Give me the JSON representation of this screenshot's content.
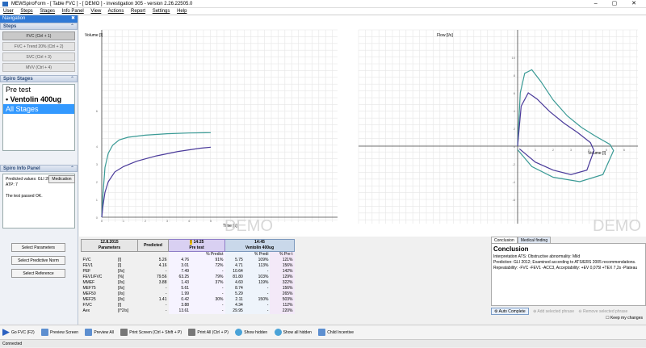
{
  "window": {
    "title": "MEWSpiroForm - [ Table FVC ] - [ DEMO ] - investigation 305 - version 2.26.22505.0",
    "controls": "– ▢ ✕"
  },
  "menu": [
    "User",
    "Steps",
    "Stages",
    "Info Panel",
    "View",
    "Actions",
    "Report",
    "Settings",
    "Help"
  ],
  "navigation": {
    "title": "Navigation",
    "pin": "✖",
    "steps_title": "Steps",
    "steps": [
      "FVC (Ctrl + 1)",
      "FVC + Trend 20% (Ctrl + 2)",
      "SVC (Ctrl + 3)",
      "MVV (Ctrl + 4)"
    ],
    "stages_title": "Spiro Stages",
    "stages": [
      "Pre test",
      "Ventolin 400ug",
      "All Stages"
    ],
    "medication_button": "Medication",
    "info_title": "Spiro Info Panel",
    "info_lines": [
      "Predicted values: GLI 2012",
      "ATP: 7",
      "",
      "The test passed OK."
    ],
    "buttons": [
      "Select Parameters",
      "Select Predictive Norm",
      "Select Reference"
    ],
    "collapse": "⌃"
  },
  "volume_time": {
    "xlabel": "Time [s]",
    "ylabel": "Volume [l]",
    "watermark": "DEMO",
    "yticks": [
      "6",
      "4",
      "3",
      "2",
      "1",
      "0"
    ],
    "xticks": [
      "0",
      "1",
      "2",
      "3",
      "4",
      "5"
    ],
    "series": [
      {
        "color": "#3a9a95",
        "points": [
          [
            0,
            0
          ],
          [
            0.05,
            1.2
          ],
          [
            0.15,
            2.8
          ],
          [
            0.3,
            3.6
          ],
          [
            0.5,
            4.05
          ],
          [
            0.8,
            4.35
          ],
          [
            1.2,
            4.5
          ],
          [
            2,
            4.62
          ],
          [
            3,
            4.7
          ],
          [
            4,
            4.74
          ],
          [
            5,
            4.76
          ]
        ]
      },
      {
        "color": "#4a3a9a",
        "points": [
          [
            0,
            0
          ],
          [
            0.05,
            0.6
          ],
          [
            0.15,
            1.4
          ],
          [
            0.3,
            2.0
          ],
          [
            0.6,
            2.55
          ],
          [
            1,
            2.85
          ],
          [
            1.6,
            3.15
          ],
          [
            2.5,
            3.45
          ],
          [
            3.5,
            3.7
          ],
          [
            4.5,
            3.88
          ],
          [
            5,
            3.94
          ]
        ]
      }
    ]
  },
  "flow_volume": {
    "xlabel": "Volume [l]",
    "ylabel": "Flow [l/s]",
    "watermark": "DEMO",
    "yticks": [
      "10",
      "8",
      "6",
      "4",
      "2",
      "0",
      "-2",
      "-4",
      "-6"
    ],
    "xticks": [
      "1",
      "2",
      "3",
      "4",
      "5",
      "6"
    ],
    "series": [
      {
        "color": "#3a9a95",
        "points": [
          [
            0,
            0
          ],
          [
            0.15,
            6
          ],
          [
            0.4,
            8.2
          ],
          [
            0.8,
            8.6
          ],
          [
            1.3,
            7.3
          ],
          [
            2,
            5.2
          ],
          [
            2.8,
            3.4
          ],
          [
            3.6,
            2.1
          ],
          [
            4.4,
            1.1
          ],
          [
            5.2,
            0.2
          ],
          [
            5.4,
            -0.5
          ],
          [
            4.8,
            -3.2
          ],
          [
            3.5,
            -4.0
          ],
          [
            2,
            -3.5
          ],
          [
            0.8,
            -2.3
          ],
          [
            0,
            -0.4
          ]
        ]
      },
      {
        "color": "#4a3a9a",
        "points": [
          [
            0,
            0
          ],
          [
            0.2,
            4.5
          ],
          [
            0.6,
            6
          ],
          [
            1.1,
            5.3
          ],
          [
            1.8,
            3.9
          ],
          [
            2.6,
            2.6
          ],
          [
            3.4,
            1.5
          ],
          [
            4.1,
            0.4
          ],
          [
            4.3,
            -0.5
          ],
          [
            3.9,
            -2.7
          ],
          [
            3,
            -3.2
          ],
          [
            2,
            -2.7
          ],
          [
            1,
            -1.8
          ],
          [
            0.1,
            -0.3
          ]
        ]
      }
    ]
  },
  "table": {
    "date": "12.8.2015",
    "parameters_label": "Parameters",
    "predicted_label": "Predicted",
    "pre": {
      "time": "14:25",
      "name": "Pre test",
      "pct_label": "% Predict"
    },
    "vent": {
      "time": "14:45",
      "name": "Ventolin 400ug",
      "pct_label": "% Predi",
      "pre_label": "% Pre t"
    },
    "rows": [
      {
        "param": "FVC",
        "unit": "[l]",
        "pred": "5.26",
        "pre": "4.76",
        "pre_pct": "91%",
        "vent": "5.75",
        "vent_pct": "109%",
        "vent_pre": "121%"
      },
      {
        "param": "FEV1",
        "unit": "[l]",
        "pred": "4.16",
        "pre": "3.01",
        "pre_pct": "72%",
        "vent": "4.71",
        "vent_pct": "113%",
        "vent_pre": "156%"
      },
      {
        "param": "PEF",
        "unit": "[l/s]",
        "pred": "-",
        "pre": "7.49",
        "pre_pct": "-",
        "vent": "10.64",
        "vent_pct": "-",
        "vent_pre": "142%"
      },
      {
        "param": "FEV1/FVC",
        "unit": "[%]",
        "pred": "79.56",
        "pre": "63.25",
        "pre_pct": "79%",
        "vent": "81.80",
        "vent_pct": "103%",
        "vent_pre": "129%"
      },
      {
        "param": "MMEF",
        "unit": "[l/s]",
        "pred": "3.88",
        "pre": "1.43",
        "pre_pct": "37%",
        "vent": "4.60",
        "vent_pct": "119%",
        "vent_pre": "322%"
      },
      {
        "param": "MEF75",
        "unit": "[l/s]",
        "pred": "-",
        "pre": "5.61",
        "pre_pct": "-",
        "vent": "8.74",
        "vent_pct": "-",
        "vent_pre": "156%"
      },
      {
        "param": "MEF50",
        "unit": "[l/s]",
        "pred": "-",
        "pre": "1.99",
        "pre_pct": "-",
        "vent": "5.29",
        "vent_pct": "-",
        "vent_pre": "265%"
      },
      {
        "param": "MEF25",
        "unit": "[l/s]",
        "pred": "1.41",
        "pre": "0.42",
        "pre_pct": "30%",
        "vent": "2.11",
        "vent_pct": "150%",
        "vent_pre": "503%"
      },
      {
        "param": "FIVC",
        "unit": "[l]",
        "pred": "-",
        "pre": "3.88",
        "pre_pct": "-",
        "vent": "4.34",
        "vent_pct": "-",
        "vent_pre": "112%"
      },
      {
        "param": "Aex",
        "unit": "[l^2/s]",
        "pred": "-",
        "pre": "13.61",
        "pre_pct": "-",
        "vent": "29.95",
        "vent_pct": "-",
        "vent_pre": "220%"
      }
    ]
  },
  "conclusion": {
    "tabs": [
      "Conclusion",
      "Medical finding"
    ],
    "title": "Conclusion",
    "lines": [
      "Interpretation ATS: Obstructive abnormality: Mild",
      "Prediction: GLI 2012; Examined according to ATS/ERS 2005 recommendations.",
      "Repeatability: -FVC -FEV1 -ACC3, Acceptability: +EV 0,075l +TEX 7,2s -Plateau"
    ],
    "auto_complete": "Auto Complete",
    "add_phrase": "Add selected phrase",
    "remove_phrase": "Remove selected phrase",
    "keep_changes": "Keep my changes"
  },
  "toolbar": [
    "Go FVC (F2)",
    "Preview Screen",
    "Preview All",
    "Print Screen (Ctrl + Shift + P)",
    "Print All (Ctrl + P)",
    "Show hidden",
    "Show all hidden",
    "Child Incentive"
  ],
  "status": "Connected",
  "colors": {
    "pre_test": "#4a3a9a",
    "ventolin": "#3a9a95",
    "nav_header": "#2f79d6",
    "selected_stage": "#3399ff"
  }
}
